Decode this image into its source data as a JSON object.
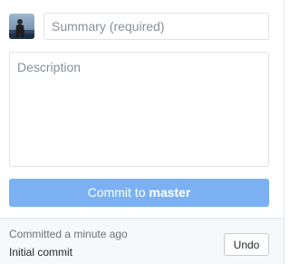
{
  "commit_form": {
    "summary": {
      "value": "",
      "placeholder": "Summary (required)"
    },
    "description": {
      "value": "",
      "placeholder": "Description"
    },
    "commit_button": {
      "prefix": "Commit to ",
      "branch": "master"
    }
  },
  "last_commit": {
    "time": "Committed a minute ago",
    "message": "Initial commit",
    "undo_label": "Undo"
  },
  "colors": {
    "commit_button_bg": "#7bb1f2",
    "footer_bg": "#f6f8fa",
    "border": "#dfe2e5"
  },
  "icons": {
    "avatar": "user-avatar"
  }
}
